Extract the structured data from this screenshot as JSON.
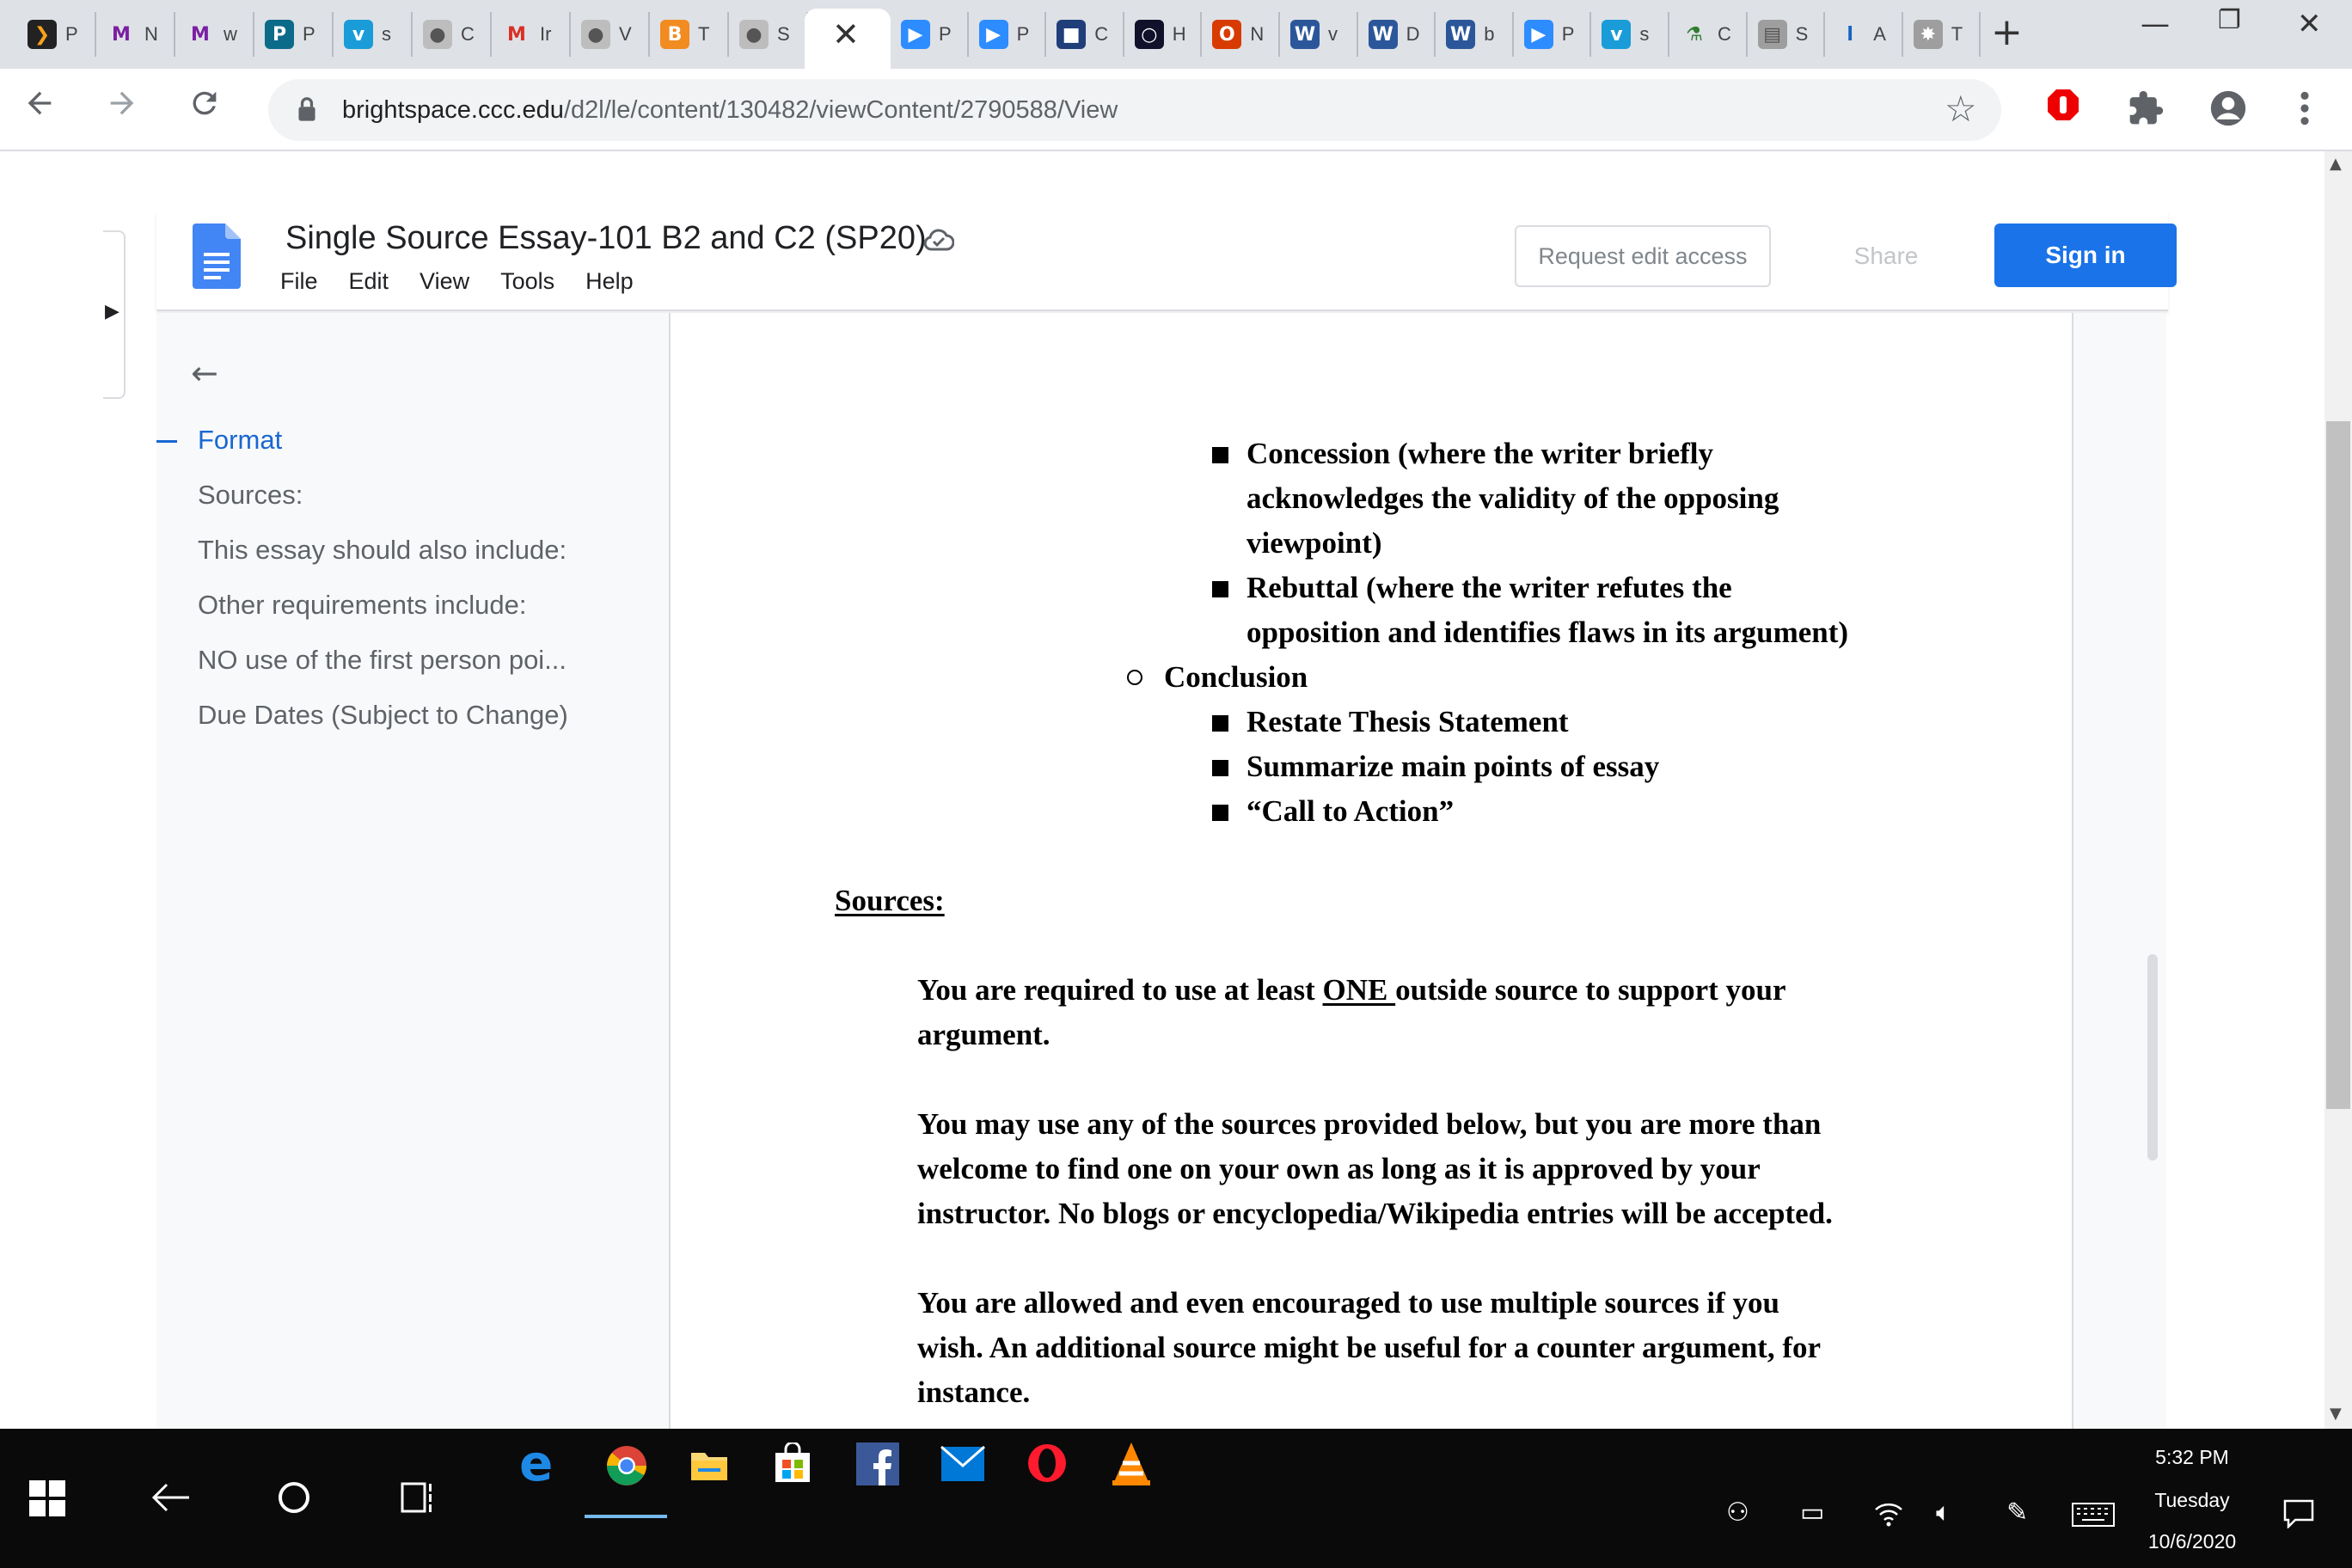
{
  "browser": {
    "tabs": [
      {
        "letter": "❯",
        "title": "P",
        "color": "#f6a21c",
        "bg": "#222222"
      },
      {
        "letter": "M",
        "title": "N",
        "color": "#7b1fa2",
        "bg": ""
      },
      {
        "letter": "M",
        "title": "w",
        "color": "#7b1fa2",
        "bg": ""
      },
      {
        "letter": "P",
        "title": "P",
        "color": "#ffffff",
        "bg": "#0d6b8a"
      },
      {
        "letter": "v",
        "title": "s",
        "color": "#ffffff",
        "bg": "#1a9cd8"
      },
      {
        "letter": "●",
        "title": "C",
        "color": "#555555",
        "bg": "#bdbdbd"
      },
      {
        "letter": "M",
        "title": "Ir",
        "color": "#d93025",
        "bg": ""
      },
      {
        "letter": "●",
        "title": "V",
        "color": "#555555",
        "bg": "#bdbdbd"
      },
      {
        "letter": "B",
        "title": "T",
        "color": "#ffffff",
        "bg": "#f28b20"
      },
      {
        "letter": "●",
        "title": "S",
        "color": "#555555",
        "bg": "#bdbdbd"
      }
    ],
    "tabs_right": [
      {
        "letter": "▶",
        "title": "P",
        "color": "#ffffff",
        "bg": "#2d8cff"
      },
      {
        "letter": "▶",
        "title": "P",
        "color": "#ffffff",
        "bg": "#2d8cff"
      },
      {
        "letter": "■",
        "title": "C",
        "color": "#ffffff",
        "bg": "#1f3e7a"
      },
      {
        "letter": "○",
        "title": "H",
        "color": "#ffffff",
        "bg": "#11112b"
      },
      {
        "letter": "O",
        "title": "N",
        "color": "#ffffff",
        "bg": "#d83b01"
      },
      {
        "letter": "W",
        "title": "v",
        "color": "#ffffff",
        "bg": "#2b579a"
      },
      {
        "letter": "W",
        "title": "D",
        "color": "#ffffff",
        "bg": "#2b579a"
      },
      {
        "letter": "W",
        "title": "b",
        "color": "#ffffff",
        "bg": "#2b579a"
      },
      {
        "letter": "▶",
        "title": "P",
        "color": "#ffffff",
        "bg": "#2d8cff"
      },
      {
        "letter": "v",
        "title": "s",
        "color": "#ffffff",
        "bg": "#1a9cd8"
      },
      {
        "letter": "⚗",
        "title": "C",
        "color": "#2e7d32",
        "bg": ""
      },
      {
        "letter": "▤",
        "title": "S",
        "color": "#555555",
        "bg": "#9e9e9e"
      },
      {
        "letter": "l",
        "title": "A",
        "color": "#1565c0",
        "bg": ""
      },
      {
        "letter": "✸",
        "title": "T",
        "color": "#ffffff",
        "bg": "#9e9e9e"
      }
    ],
    "active_tab_close": "✕",
    "new_tab": "+",
    "window_controls": {
      "minimize": "—",
      "restore": "❐",
      "close": "✕"
    },
    "url_host": "brightspace.ccc.edu",
    "url_path": "/d2l/le/content/130482/viewContent/2790588/View",
    "icons": {
      "back": "arrow-left-icon",
      "forward": "arrow-right-icon",
      "reload": "reload-icon",
      "lock": "lock-icon",
      "star": "star-icon",
      "extensions": "puzzle-icon",
      "profile": "avatar-icon",
      "menu": "kebab-menu-icon"
    }
  },
  "docs": {
    "title": "Single Source Essay-101 B2 and C2 (SP20)",
    "menu": [
      "File",
      "Edit",
      "View",
      "Tools",
      "Help"
    ],
    "request_edit": "Request edit access",
    "share": "Share",
    "sign_in": "Sign in",
    "colors": {
      "accent": "#1a73e8",
      "outline_active": "#1967d2"
    }
  },
  "outline": {
    "back_arrow": "←",
    "items": [
      {
        "label": "Format",
        "active": true
      },
      {
        "label": "Sources:",
        "active": false
      },
      {
        "label": "This essay should also include:",
        "active": false
      },
      {
        "label": "Other requirements include:",
        "active": false
      },
      {
        "label": "NO use of the first person poi...",
        "active": false
      },
      {
        "label": "Due Dates (Subject to Change)",
        "active": false
      }
    ]
  },
  "document": {
    "concession": [
      "Concession (where the writer briefly",
      "acknowledges the validity of the opposing",
      "viewpoint)"
    ],
    "rebuttal": [
      "Rebuttal (where the writer refutes the",
      "opposition and identifies flaws in its argument)"
    ],
    "conclusion": "Conclusion",
    "conclusion_items": [
      "Restate Thesis Statement",
      "Summarize main points of essay",
      "“Call to Action”"
    ],
    "sources_heading": "Sources:",
    "para1": {
      "before": "You are required to use at least ",
      "emph": "ONE ",
      "after": "outside source to support your",
      "line2": "argument."
    },
    "para2": [
      "You may use any of the sources provided below, but you are more than",
      "welcome to find one on your own as long as it is approved by your",
      "instructor. No blogs or encyclopedia/Wikipedia entries will be accepted."
    ],
    "para3": [
      "You are allowed and even encouraged to use multiple sources if you",
      "wish. An additional source might be useful for a counter argument, for",
      "instance."
    ]
  },
  "taskbar": {
    "clock_time": "5:32 PM",
    "clock_day": "Tuesday",
    "clock_date": "10/6/2020"
  }
}
